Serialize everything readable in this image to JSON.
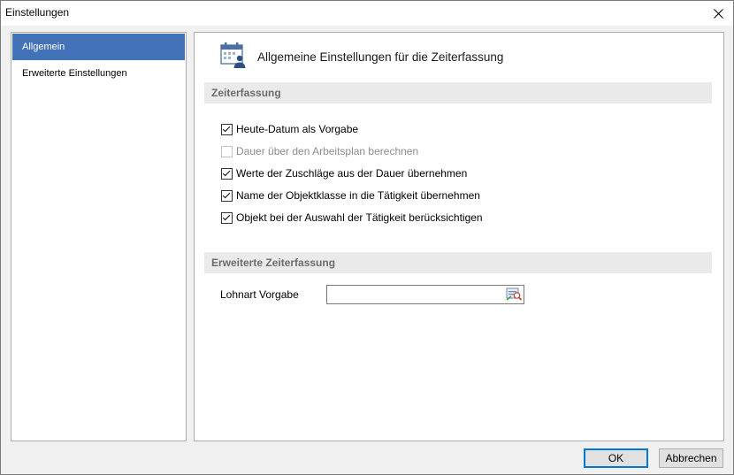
{
  "window": {
    "title": "Einstellungen"
  },
  "nav": {
    "items": [
      {
        "label": "Allgemein",
        "selected": true
      },
      {
        "label": "Erweiterte Einstellungen",
        "selected": false
      }
    ]
  },
  "content": {
    "header_title": "Allgemeine Einstellungen für die Zeiterfassung",
    "header_icon": "calendar-person-icon",
    "section1": {
      "title": "Zeiterfassung",
      "checkboxes": [
        {
          "label": "Heute-Datum als Vorgabe",
          "checked": true,
          "enabled": true
        },
        {
          "label": "Dauer über den Arbeitsplan berechnen",
          "checked": false,
          "enabled": false
        },
        {
          "label": "Werte der Zuschläge aus der Dauer übernehmen",
          "checked": true,
          "enabled": true
        },
        {
          "label": "Name der Objektklasse in die Tätigkeit übernehmen",
          "checked": true,
          "enabled": true
        },
        {
          "label": "Objekt bei der Auswahl der Tätigkeit berücksichtigen",
          "checked": true,
          "enabled": true
        }
      ]
    },
    "section2": {
      "title": "Erweiterte Zeiterfassung",
      "lohnart_label": "Lohnart Vorgabe",
      "lohnart_value": ""
    }
  },
  "buttons": {
    "ok": "OK",
    "cancel": "Abbrechen"
  },
  "colors": {
    "selection": "#4472b8",
    "default_button_border": "#0078d7"
  }
}
